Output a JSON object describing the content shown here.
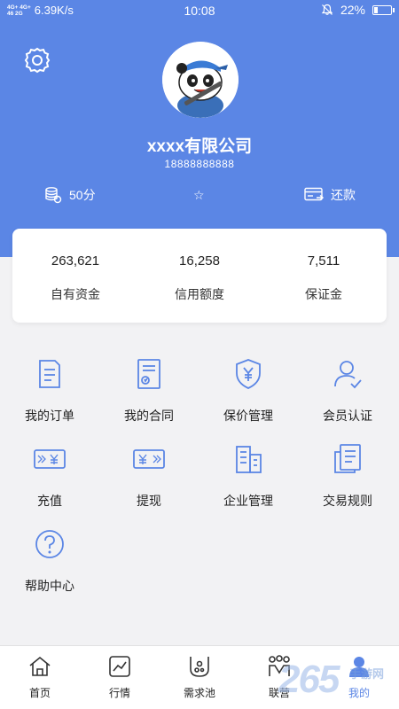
{
  "status_bar": {
    "network_top": "4G+ 4G+",
    "network_bottom": "46 2G",
    "speed": "6.39K/s",
    "time": "10:08",
    "battery": "22%",
    "battery_level": 0.22
  },
  "profile": {
    "company_name": "xxxx有限公司",
    "phone": "18888888888",
    "points": "50分",
    "star": "☆",
    "repay_label": "还款"
  },
  "summary": [
    {
      "value": "263,621",
      "label": "自有资金"
    },
    {
      "value": "16,258",
      "label": "信用额度"
    },
    {
      "value": "7,511",
      "label": "保证金"
    }
  ],
  "menu": [
    {
      "label": "我的订单",
      "icon": "order-icon"
    },
    {
      "label": "我的合同",
      "icon": "contract-icon"
    },
    {
      "label": "保价管理",
      "icon": "price-protect-icon"
    },
    {
      "label": "会员认证",
      "icon": "member-verify-icon"
    },
    {
      "label": "充值",
      "icon": "recharge-icon"
    },
    {
      "label": "提现",
      "icon": "withdraw-icon"
    },
    {
      "label": "企业管理",
      "icon": "enterprise-icon"
    },
    {
      "label": "交易规则",
      "icon": "rules-icon"
    },
    {
      "label": "帮助中心",
      "icon": "help-icon"
    }
  ],
  "tabs": [
    {
      "label": "首页",
      "icon": "home-icon"
    },
    {
      "label": "行情",
      "icon": "market-icon"
    },
    {
      "label": "需求池",
      "icon": "demand-pool-icon"
    },
    {
      "label": "联营",
      "icon": "joint-icon"
    },
    {
      "label": "我的",
      "icon": "profile-icon",
      "active": true
    }
  ],
  "watermark": {
    "big": "265",
    "small": "手游网"
  },
  "colors": {
    "primary": "#5b86e5",
    "background": "#f2f2f4",
    "icon_blue": "#5b86e5"
  }
}
